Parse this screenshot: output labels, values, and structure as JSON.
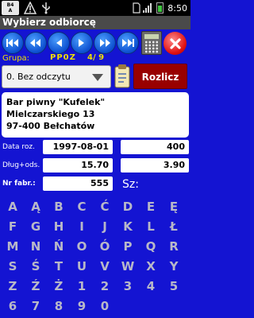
{
  "status_bar": {
    "logo_text": "Basic4 Android",
    "time": "8:50"
  },
  "title": "Wybierz odbiorcę",
  "group": {
    "label": "Grupa:",
    "value": "PP0Z",
    "count": "4/ 9"
  },
  "dropdown": {
    "selected": "0. Bez odczytu"
  },
  "rozlicz_label": "Rozlicz",
  "address": {
    "name": "Bar piwny \"Kufelek\"",
    "street": "Mielczarskiego 13",
    "city": "97-400 Bełchatów"
  },
  "info": {
    "date_label": "Data roz.",
    "date_value": "1997-08-01",
    "date_right": "400",
    "debt_label": "Dług+ods.",
    "debt_value": "15.70",
    "debt_right": "3.90",
    "nr_label": "Nr fabr.:",
    "nr_value": "555",
    "sz_label": "Sz:"
  },
  "keyboard": {
    "row1": [
      "A",
      "Ą",
      "B",
      "C",
      "Ć",
      "D",
      "E",
      "Ę"
    ],
    "row2": [
      "F",
      "G",
      "H",
      "I",
      "J",
      "K",
      "L",
      "Ł"
    ],
    "row3": [
      "M",
      "N",
      "Ń",
      "O",
      "Ó",
      "P",
      "Q",
      "R"
    ],
    "row4": [
      "S",
      "Ś",
      "T",
      "U",
      "V",
      "W",
      "X",
      "Y"
    ],
    "row5": [
      "Z",
      "Ź",
      "Ż",
      "1",
      "2",
      "3",
      "4",
      "5"
    ],
    "row6": [
      "6",
      "7",
      "8",
      "9",
      "0"
    ]
  },
  "colors": {
    "background": "#1414d2",
    "accent_yellow": "#f0e000",
    "rozlicz_bg": "#990000",
    "key_text": "#b8b8c8"
  }
}
